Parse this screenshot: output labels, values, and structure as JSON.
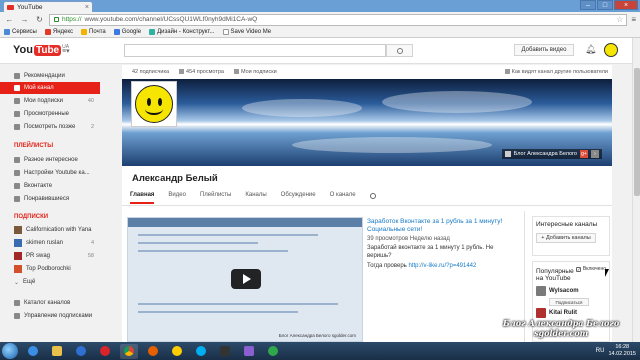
{
  "browser": {
    "tab_title": "YouTube",
    "url_scheme": "https://",
    "url_rest": "www.youtube.com/channel/UCssQU1WLf0nyh9dMi1CA-wQ",
    "bookmarks": [
      "Сервисы",
      "Яндекс",
      "Почта",
      "Google",
      "Дизайн - Конструкт...",
      "Save Video Me"
    ]
  },
  "header": {
    "logo_you": "You",
    "logo_tube": "Tube",
    "logo_region": "UA",
    "search_placeholder": "",
    "upload_label": "Добавить видео"
  },
  "sidebar": {
    "main": [
      {
        "label": "Рекомендации",
        "count": ""
      },
      {
        "label": "Мой канал",
        "count": ""
      },
      {
        "label": "Мои подписки",
        "count": "40"
      },
      {
        "label": "Просмотренные",
        "count": ""
      },
      {
        "label": "Посмотреть позже",
        "count": "2"
      }
    ],
    "playlists_header": "ПЛЕЙЛИСТЫ",
    "playlists": [
      {
        "label": "Разное интересное"
      },
      {
        "label": "Настройки Youtube ка..."
      },
      {
        "label": "Вконтакте"
      },
      {
        "label": "Понравившиеся"
      }
    ],
    "subs_header": "ПОДПИСКИ",
    "subs": [
      {
        "label": "Californication with Yana",
        "count": ""
      },
      {
        "label": "skimen ruslan",
        "count": "4"
      },
      {
        "label": "PR swag",
        "count": "58"
      },
      {
        "label": "Top Podborochki",
        "count": ""
      },
      {
        "label": "Ещё",
        "count": ""
      }
    ],
    "footer": [
      {
        "label": "Каталог каналов"
      },
      {
        "label": "Управление подписками"
      }
    ]
  },
  "channel": {
    "subscribers": "42 подписчика",
    "views": "454 просмотра",
    "subscriptions": "Мои подписки",
    "view_as": "Как видят канал другие пользователи",
    "banner_link": "Блог Александра Белого",
    "name": "Александр Белый",
    "tabs": [
      "Главная",
      "Видео",
      "Плейлисты",
      "Каналы",
      "Обсуждение",
      "О канале"
    ],
    "video": {
      "title": "Заработок Вконтакте за 1 рубль за 1 минуту! Социальные сети!",
      "meta": "39 просмотров  Неделю назад",
      "desc": "Заработай вконтакте за 1 минуту 1 рубль. Не веришь?",
      "desc2_prefix": "Тогда проверь ",
      "desc2_link": "http://v-like.ru/?p=491442",
      "thumb_caption": "Блог Александра Белого sgolder.com"
    },
    "interesting": {
      "title": "Интересные каналы",
      "add_label": "+ Добавить каналы"
    },
    "popular": {
      "title": "Популярные на YouTube",
      "toggle_label": "Включено",
      "channels": [
        {
          "name": "Wylsacom",
          "button": "Подписаться"
        },
        {
          "name": "Kitai Rulit",
          "button": ""
        }
      ]
    }
  },
  "watermark": {
    "line1": "Блог Александра Белого",
    "line2": "sgolder.com"
  },
  "taskbar": {
    "lang": "RU",
    "time": "16:28",
    "date": "14.02.2015"
  },
  "colors": {
    "accent_red": "#e62117",
    "link_blue": "#167ac6",
    "taskbar": "#1a2f47"
  }
}
